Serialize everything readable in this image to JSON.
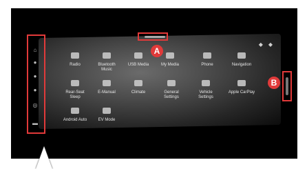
{
  "apps": [
    {
      "label": "Radio",
      "icon": "radio-icon"
    },
    {
      "label": "Bluetooth\nMusic",
      "icon": "bluetooth-music-icon"
    },
    {
      "label": "USB Media",
      "icon": "usb-icon"
    },
    {
      "label": "My Media",
      "icon": "media-icon"
    },
    {
      "label": "Phone",
      "icon": "phone-icon"
    },
    {
      "label": "Navigation",
      "icon": "navigation-icon"
    },
    {
      "label": "Rear-Seat\nSleep",
      "icon": "rear-seat-icon"
    },
    {
      "label": "E-Manual",
      "icon": "manual-icon"
    },
    {
      "label": "Climate",
      "icon": "climate-icon"
    },
    {
      "label": "General\nSettings",
      "icon": "settings-icon"
    },
    {
      "label": "Vehicle\nSettings",
      "icon": "vehicle-icon"
    },
    {
      "label": "Apple CarPlay",
      "icon": "carplay-icon"
    },
    {
      "label": "Android Auto",
      "icon": "android-auto-icon"
    },
    {
      "label": "EV Mode",
      "icon": "ev-mode-icon"
    }
  ],
  "callouts": {
    "a": "A",
    "b": "B"
  },
  "colors": {
    "callout": "#e03a3a",
    "background": "#000000"
  }
}
